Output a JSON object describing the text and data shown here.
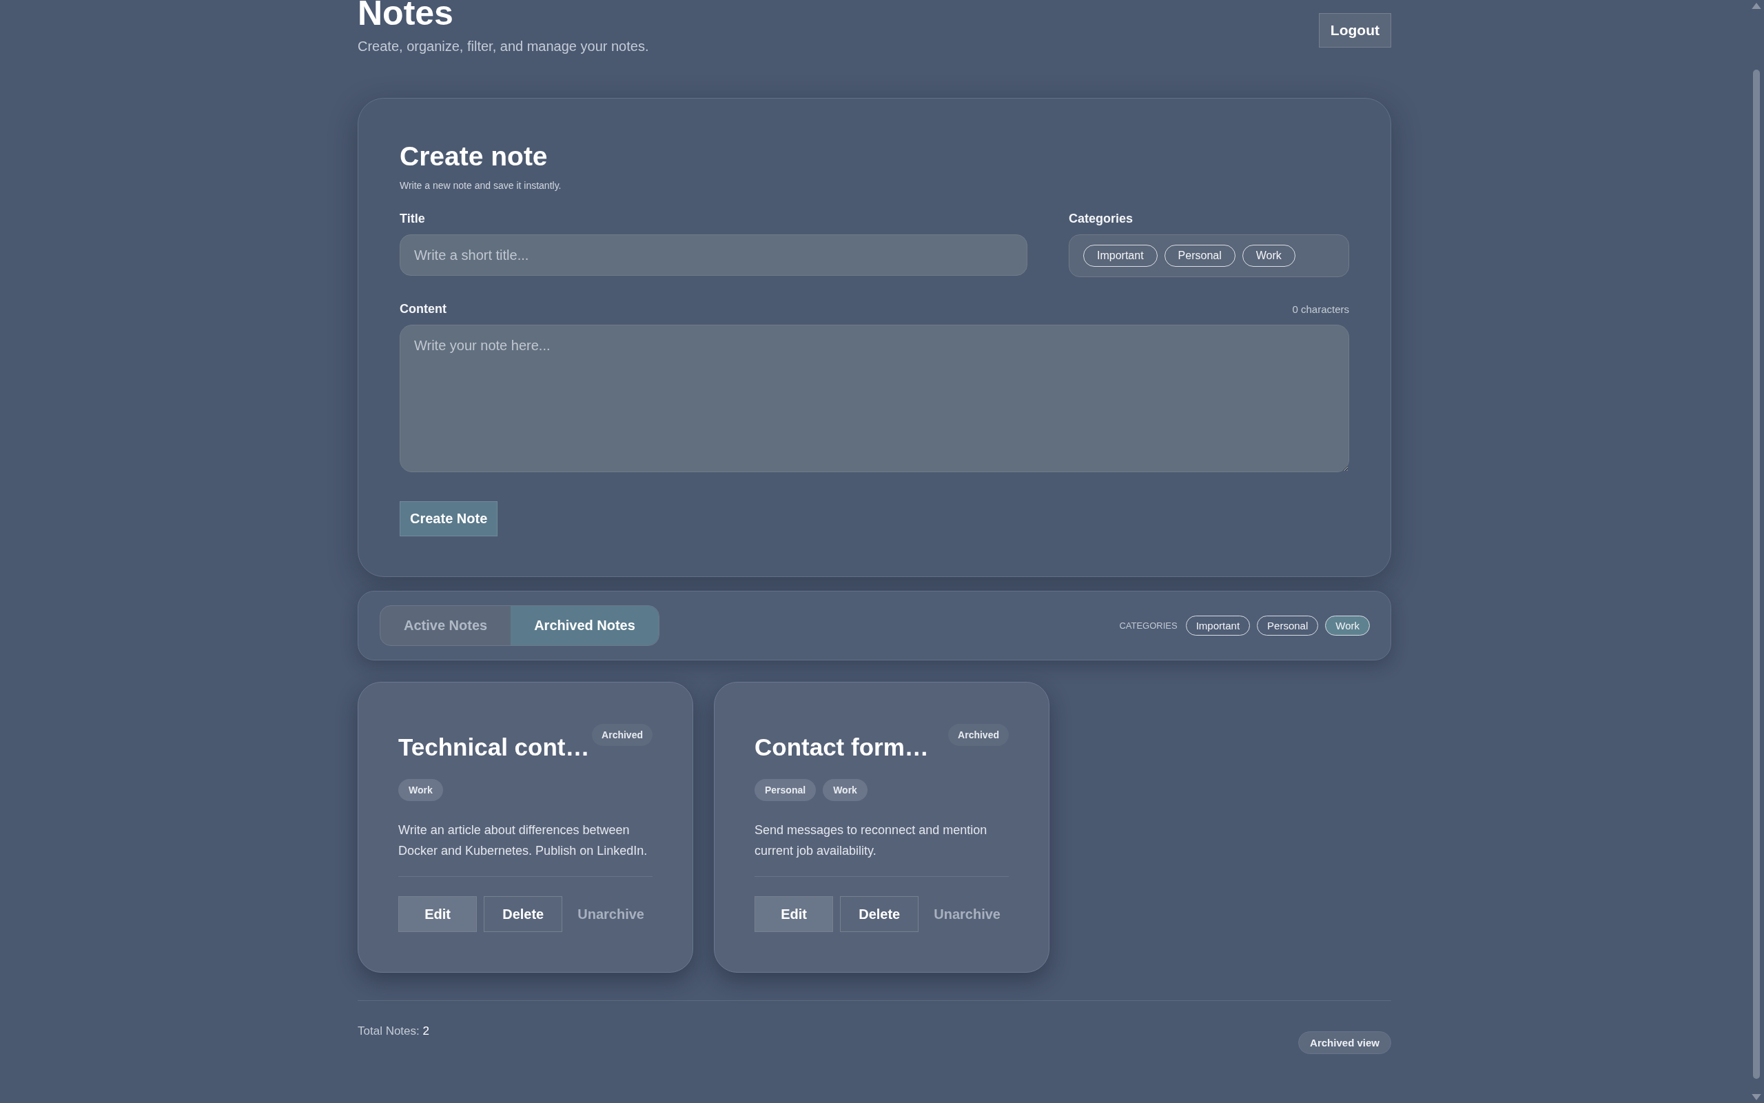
{
  "header": {
    "title": "Notes",
    "subtitle": "Create, organize, filter, and manage your notes.",
    "logout": "Logout"
  },
  "create_form": {
    "title": "Create note",
    "subtitle": "Write a new note and save it instantly.",
    "title_field": {
      "label": "Title",
      "placeholder": "Write a short title..."
    },
    "categories": {
      "label": "Categories",
      "options": [
        {
          "label": "Important",
          "selected": false
        },
        {
          "label": "Personal",
          "selected": false
        },
        {
          "label": "Work",
          "selected": false
        }
      ]
    },
    "content_field": {
      "label": "Content",
      "counter": "0 characters",
      "placeholder": "Write your note here..."
    },
    "submit": "Create Note"
  },
  "filter_bar": {
    "tabs": [
      {
        "label": "Active Notes",
        "selected": false
      },
      {
        "label": "Archived Notes",
        "selected": true
      }
    ],
    "categories_label": "CATEGORIES",
    "categories": [
      {
        "label": "Important",
        "selected": false
      },
      {
        "label": "Personal",
        "selected": false
      },
      {
        "label": "Work",
        "selected": true
      }
    ]
  },
  "notes": [
    {
      "title": "Technical cont…",
      "status": "Archived",
      "tags": [
        "Work"
      ],
      "content": "Write an article about differences between Docker and Kubernetes. Publish on LinkedIn.",
      "actions": [
        {
          "label": "Edit",
          "kind": "primary"
        },
        {
          "label": "Delete",
          "kind": "secondary"
        },
        {
          "label": "Unarchive",
          "kind": "text"
        }
      ]
    },
    {
      "title": "Contact form…",
      "status": "Archived",
      "tags": [
        "Personal",
        "Work"
      ],
      "content": "Send messages to reconnect and mention current job availability.",
      "actions": [
        {
          "label": "Edit",
          "kind": "primary"
        },
        {
          "label": "Delete",
          "kind": "secondary"
        },
        {
          "label": "Unarchive",
          "kind": "text"
        }
      ]
    }
  ],
  "footer": {
    "total_label": "Total Notes:",
    "total": "2",
    "view_badge": "Archived view"
  }
}
